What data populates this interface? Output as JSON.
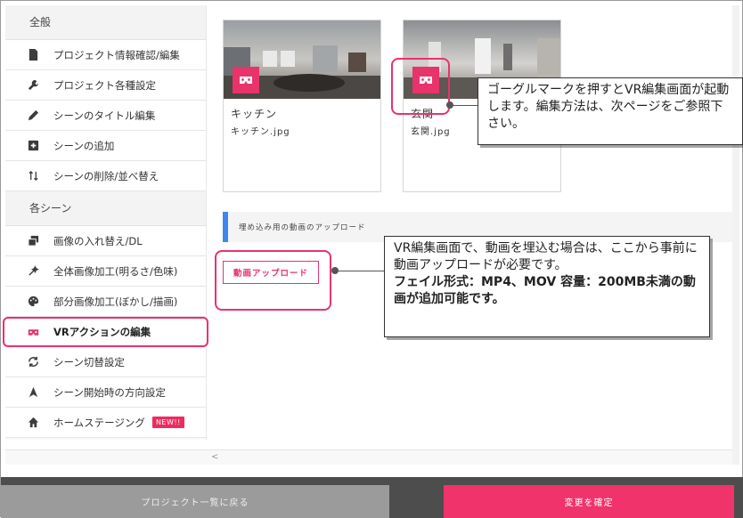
{
  "sidebar": {
    "section_general": "全般",
    "general_items": [
      {
        "label": "プロジェクト情報確認/編集",
        "icon": "document-icon"
      },
      {
        "label": "プロジェクト各種設定",
        "icon": "wrench-icon"
      },
      {
        "label": "シーンのタイトル編集",
        "icon": "pencil-icon"
      },
      {
        "label": "シーンの追加",
        "icon": "plus-square-icon"
      },
      {
        "label": "シーンの削除/並べ替え",
        "icon": "sort-arrows-icon"
      }
    ],
    "section_scenes": "各シーン",
    "scene_items": [
      {
        "label": "画像の入れ替え/DL",
        "icon": "swap-image-icon"
      },
      {
        "label": "全体画像加工(明るさ/色味)",
        "icon": "magic-wand-icon"
      },
      {
        "label": "部分画像加工(ぼかし/描画)",
        "icon": "palette-icon"
      },
      {
        "label": "VRアクションの編集",
        "icon": "vr-goggle-icon"
      },
      {
        "label": "シーン切替設定",
        "icon": "refresh-icon"
      },
      {
        "label": "シーン開始時の方向設定",
        "icon": "direction-arrow-icon"
      },
      {
        "label": "ホームステージング",
        "icon": "home-icon"
      }
    ],
    "new_badge": "NEW!!"
  },
  "scenes": [
    {
      "title": "キッチン",
      "file": "キッチン.jpg"
    },
    {
      "title": "玄関",
      "file": "玄関.jpg"
    }
  ],
  "embed": {
    "heading": "埋め込み用の動画のアップロード",
    "upload_button": "動画アップロード"
  },
  "callouts": {
    "goggle_note": "ゴーグルマークを押すとVR編集画面が起動します。編集方法は、次ページをご参照下さい。",
    "upload_note_line1": "VR編集画面で、動画を埋込む場合は、ここから事前に動画アップロードが必要です。",
    "upload_note_line2": "フェイル形式：MP4、MOV 容量：200MB未満の動画が追加可能です。"
  },
  "footer": {
    "back_button": "プロジェクト一覧に戻る",
    "save_button": "変更を確定"
  },
  "scroll_left_glyph": "<",
  "colors": {
    "accent": "#e8336b",
    "bar_blue": "#3f86f0",
    "footer_bg": "#4d4d4d",
    "back_btn": "#9b9b9b"
  }
}
